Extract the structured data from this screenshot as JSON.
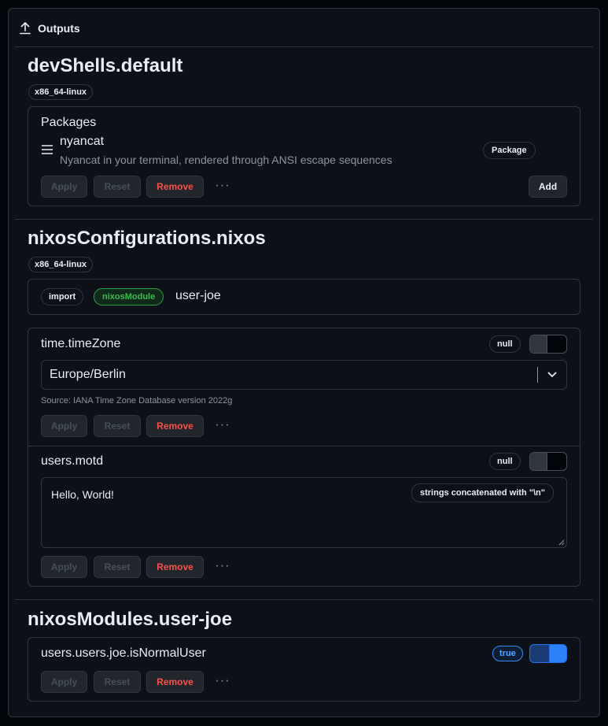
{
  "header": {
    "title": "Outputs",
    "icon": "upload-icon"
  },
  "buttons": {
    "apply": "Apply",
    "reset": "Reset",
    "remove": "Remove",
    "add": "Add",
    "more": "···"
  },
  "devshells": {
    "title": "devShells.default",
    "system": "x86_64-linux",
    "packages_label": "Packages",
    "package": {
      "name": "nyancat",
      "description": "Nyancat in your terminal, rendered through ANSI escape sequences",
      "badge": "Package",
      "icon": "hamburger-menu-icon"
    }
  },
  "nixos": {
    "title": "nixosConfigurations.nixos",
    "system": "x86_64-linux",
    "import_badge": "import",
    "module_badge": "nixosModule",
    "module_name": "user-joe",
    "timezone": {
      "label": "time.timeZone",
      "null_badge": "null",
      "value": "Europe/Berlin",
      "source": "Source: IANA Time Zone Database version 2022g"
    },
    "motd": {
      "label": "users.motd",
      "null_badge": "null",
      "value": "Hello, World!",
      "hint": "strings concatenated with \"\\n\""
    }
  },
  "modules": {
    "title": "nixosModules.user-joe",
    "option": {
      "label": "users.users.joe.isNormalUser",
      "badge": "true",
      "enabled": true
    }
  },
  "colors": {
    "background": "#0d1117",
    "border": "#30363d",
    "remove": "#f85149",
    "module_green": "#3fb950",
    "toggle_blue": "#2f81f7"
  }
}
